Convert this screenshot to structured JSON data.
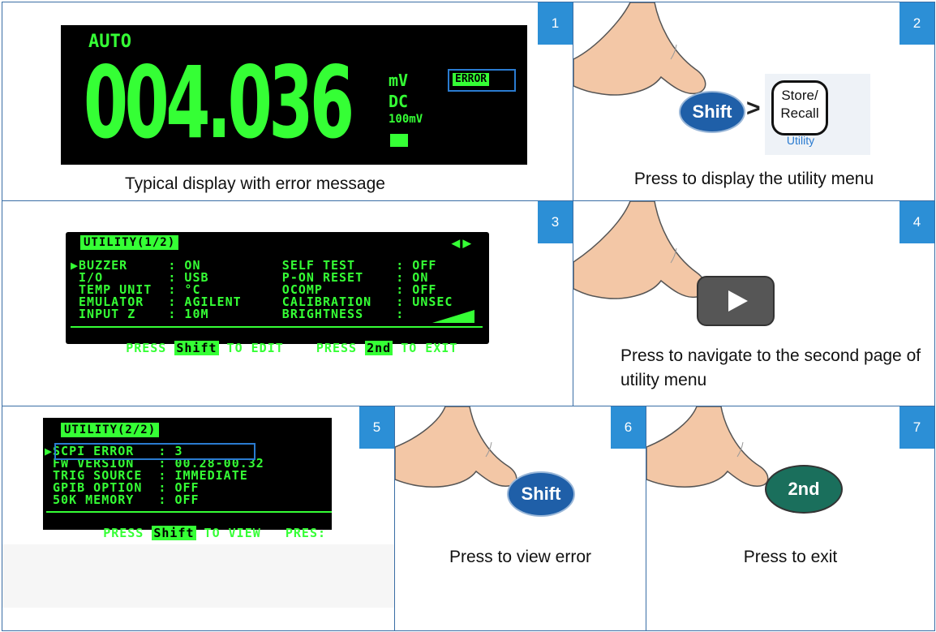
{
  "panels": [
    {
      "num": "1",
      "caption": "Typical display with error message"
    },
    {
      "num": "2",
      "caption": "Press to display the utility menu"
    },
    {
      "num": "3",
      "caption": ""
    },
    {
      "num": "4",
      "caption": "Press to navigate to the second page of utility menu"
    },
    {
      "num": "5",
      "caption": ""
    },
    {
      "num": "6",
      "caption": "Press to view error"
    },
    {
      "num": "7",
      "caption": "Press to exit"
    }
  ],
  "display1": {
    "auto": "AUTO",
    "reading": "004.036",
    "unit": "mV",
    "mode": "DC",
    "range": "100mV",
    "error": "ERROR"
  },
  "keys": {
    "shift": "Shift",
    "gt": ">",
    "store_recall": "Store/\nRecall",
    "utility": "Utility",
    "second": "2nd"
  },
  "utility1": {
    "header": "UTILITY(1/2)",
    "lines": [
      "▶BUZZER     : ON          SELF TEST     : OFF",
      " I/O        : USB         P-ON RESET    : ON",
      " TEMP UNIT  : °C          OCOMP         : OFF",
      " EMULATOR   : AGILENT     CALIBRATION   : UNSEC",
      " INPUT Z    : 10M         BRIGHTNESS    :"
    ],
    "footer_a": "PRESS ",
    "footer_shift": "Shift",
    "footer_b": " TO EDIT    PRESS ",
    "footer_2nd": "2nd",
    "footer_c": " TO EXIT"
  },
  "utility2": {
    "header": "UTILITY(2/2)",
    "lines": [
      "▶SCPI ERROR   : 3",
      " FW VERSION   : 00.28-00.32",
      " TRIG SOURCE  : IMMEDIATE",
      " GPIB OPTION  : OFF",
      " 50K MEMORY   : OFF"
    ],
    "footer_a": "PRESS ",
    "footer_shift": "Shift",
    "footer_b": " TO VIEW   PRES:"
  },
  "colors": {
    "badge": "#2c8fd6",
    "lcd_green": "#35ff35",
    "shift_key": "#1f5fa8",
    "second_key": "#1a6f5c",
    "highlight_box": "#2a7bd0"
  }
}
